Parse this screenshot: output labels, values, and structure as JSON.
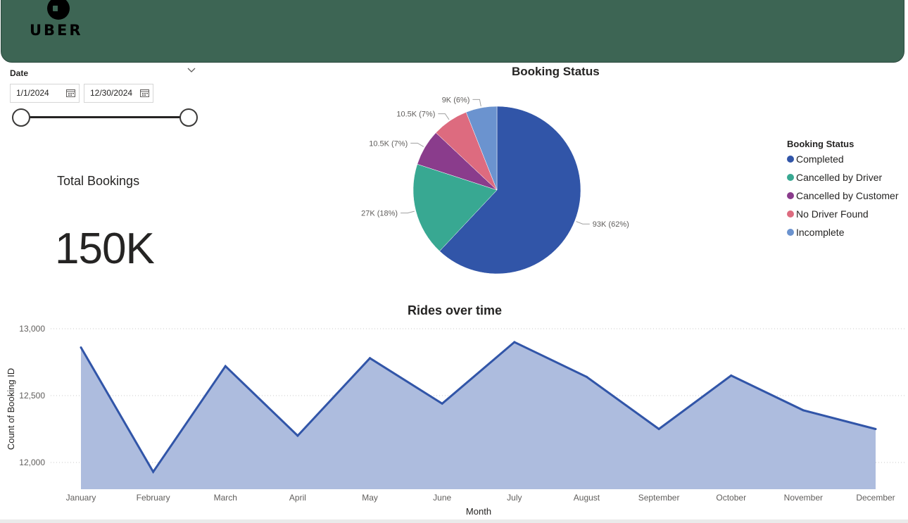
{
  "brand": {
    "logo_text": "UBER",
    "header_color": "#3d6554"
  },
  "date_slicer": {
    "title": "Date",
    "start_date": "1/1/2024",
    "end_date": "12/30/2024",
    "icons": {
      "calendar": "calendar-icon",
      "dropdown": "chevron-down-icon"
    }
  },
  "kpi": {
    "title": "Total Bookings",
    "value": "150K"
  },
  "pie": {
    "title": "Booking Status",
    "legend_title": "Booking Status",
    "slices": [
      {
        "name": "Completed",
        "value": 93,
        "label": "93K (62%)",
        "color": "#3155a8"
      },
      {
        "name": "Cancelled by Driver",
        "value": 27,
        "label": "27K (18%)",
        "color": "#38a892"
      },
      {
        "name": "Cancelled by Customer",
        "value": 10.5,
        "label": "10.5K (7%)",
        "color": "#8a3c8c"
      },
      {
        "name": "No Driver Found",
        "value": 10.5,
        "label": "10.5K (7%)",
        "color": "#dd6b7f"
      },
      {
        "name": "Incomplete",
        "value": 9,
        "label": "9K (6%)",
        "color": "#6b93cf"
      }
    ]
  },
  "chart_data": {
    "type": "area",
    "title": "Rides over time",
    "xlabel": "Month",
    "ylabel": "Count of Booking ID",
    "categories": [
      "January",
      "February",
      "March",
      "April",
      "May",
      "June",
      "July",
      "August",
      "September",
      "October",
      "November",
      "December"
    ],
    "values": [
      12860,
      11930,
      12720,
      12200,
      12780,
      12440,
      12900,
      12640,
      12250,
      12650,
      12390,
      12250
    ],
    "ylim": [
      11800,
      13000
    ],
    "yticks": [
      12000,
      12500,
      13000
    ],
    "ytick_labels": [
      "12,000",
      "12,500",
      "13,000"
    ],
    "line_color": "#3155a8",
    "fill_color": "#adbcde",
    "grid": true
  }
}
